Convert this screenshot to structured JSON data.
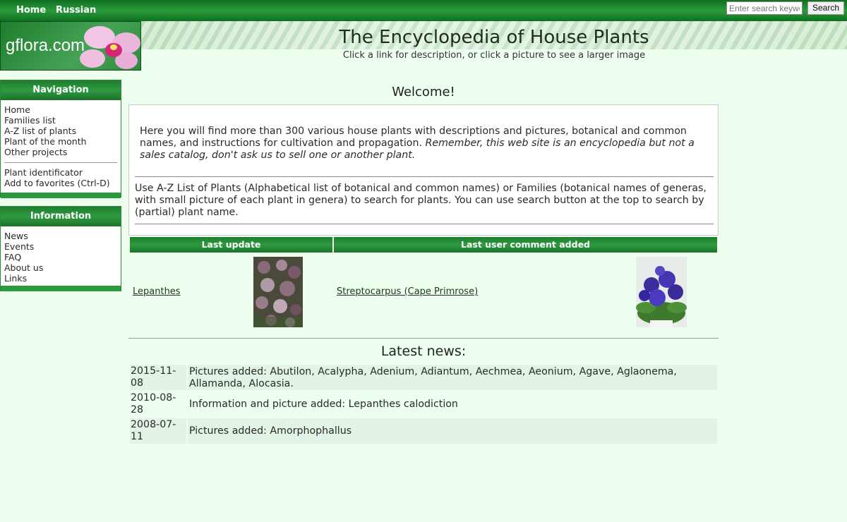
{
  "topnav": {
    "home": "Home",
    "russian": "Russian"
  },
  "search": {
    "placeholder": "Enter search keyword",
    "button_label": "Search"
  },
  "header": {
    "logo_text": "gflora.com",
    "title": "The Encyclopedia of House Plants",
    "subtitle": "Click a link for description, or click a picture to see a larger image"
  },
  "navigation": {
    "title": "Navigation",
    "items": [
      "Home",
      "Families list",
      "A-Z list of plants",
      "Plant of the month",
      "Other projects"
    ],
    "extra_items": [
      "Plant identificator",
      "Add to favorites (Ctrl-D)"
    ]
  },
  "information": {
    "title": "Information",
    "items": [
      "News",
      "Events",
      "FAQ",
      "About us",
      "Links"
    ]
  },
  "welcome": {
    "title": "Welcome!",
    "intro_plain": "Here you will find more than 300 various house plants with descriptions and pictures, botanical and common names, and instructions for cultivation and propagation.",
    "intro_italic": "Remember, this web site is an encyclopedia but not a sales catalog, don't ask us to sell one or another plant.",
    "search_help": "Use A-Z List of Plants (Alphabetical list of botanical and common names) or Families (botanical names of generas, with small picture of each plant in genera) to search for plants. You can use search button at the top to search by (partial) plant name."
  },
  "updates": {
    "last_update_header": "Last update",
    "last_comment_header": "Last user comment added",
    "last_update_plant": "Lepanthes",
    "last_comment_plant": "Streptocarpus (Cape Primrose)"
  },
  "news": {
    "title": "Latest news:",
    "items": [
      {
        "date": "2015-11-08",
        "text": "Pictures added: Abutilon, Acalypha, Adenium, Adiantum, Aechmea, Aeonium, Agave, Aglaonema, Allamanda, Alocasia."
      },
      {
        "date": "2010-08-28",
        "text": "Information and picture added: Lepanthes calodiction"
      },
      {
        "date": "2008-07-11",
        "text": "Pictures added: Amorphophallus"
      }
    ]
  }
}
